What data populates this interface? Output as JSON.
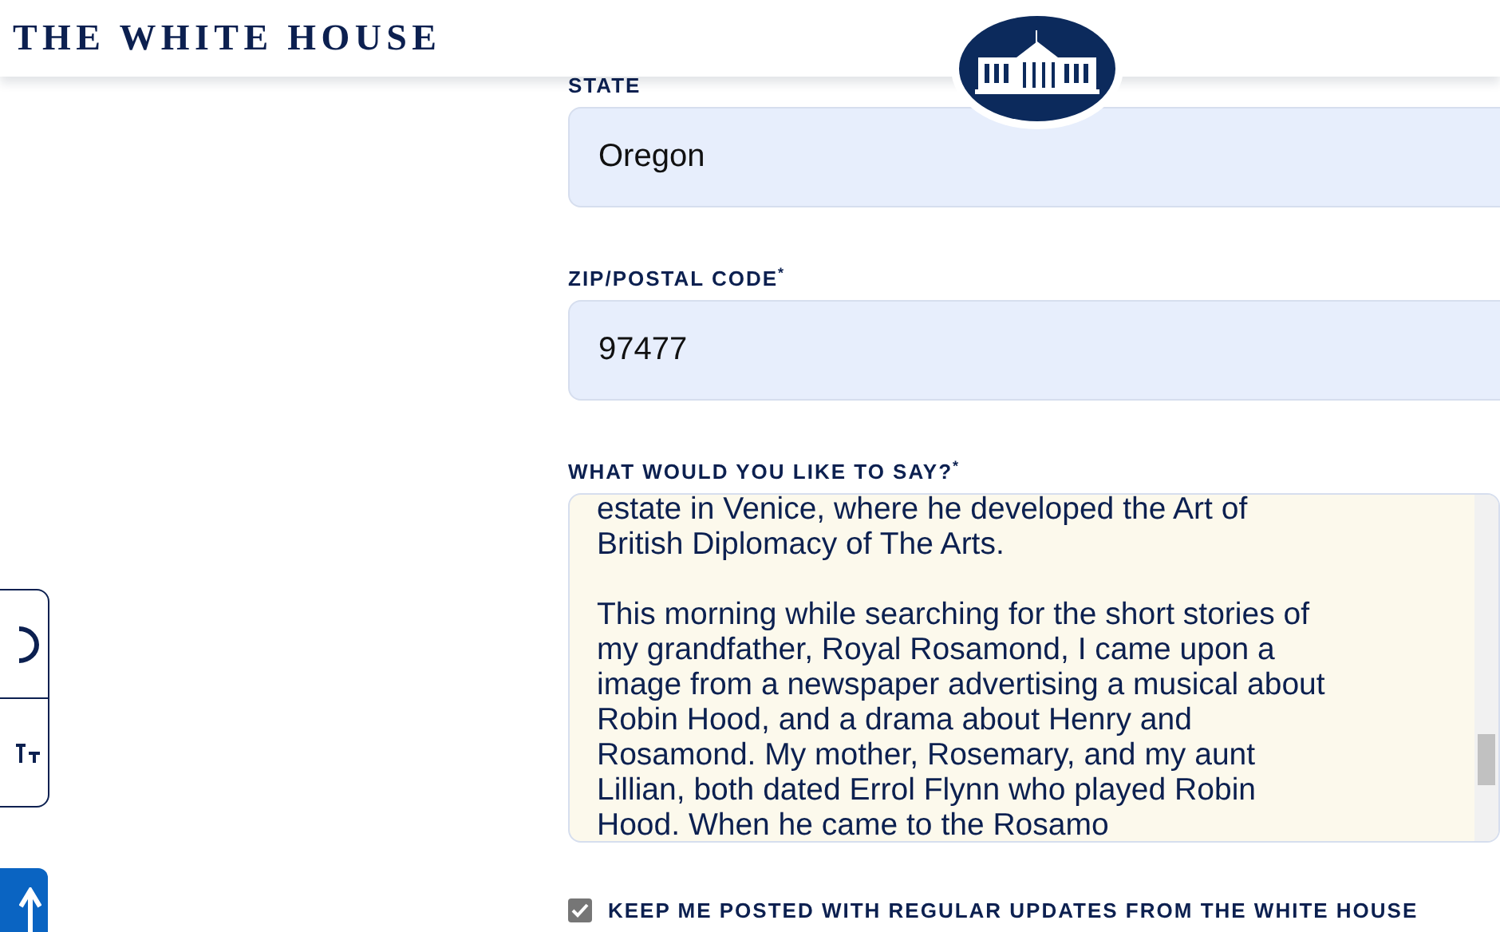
{
  "header": {
    "title": "THE WHITE HOUSE"
  },
  "fields": [
    {
      "kind": "input",
      "label": "STATE",
      "value": "Oregon"
    },
    {
      "kind": "input",
      "label": "ZIP/POSTAL CODE$^{*}$",
      "value": "97477"
    },
    {
      "kind": "textarea",
      "label": "WHAT WOULD YOU LIKE TO SAY?$^{*}$",
      "value": "estate in Venice, where he developed the Art of\nBritish Diplomacy of The Arts.\n\nThis morning while searching for the short stories of\nmy grandfather, Royal Rosamond, I came upon a\nimage from a newspaper advertising a musical about\nRobin Hood, and a drama about Henry and\nRosamond. My mother, Rosemary, and my aunt\nLillian, both dated Errol Flynn who played Robin\nHood. When he came to the Rosamo"
    }
  ],
  "updates_checkbox": {
    "label": "KEEP ME POSTED WITH REGULAR UPDATES FROM THE WHITE HOUSE",
    "checked": true
  }
}
